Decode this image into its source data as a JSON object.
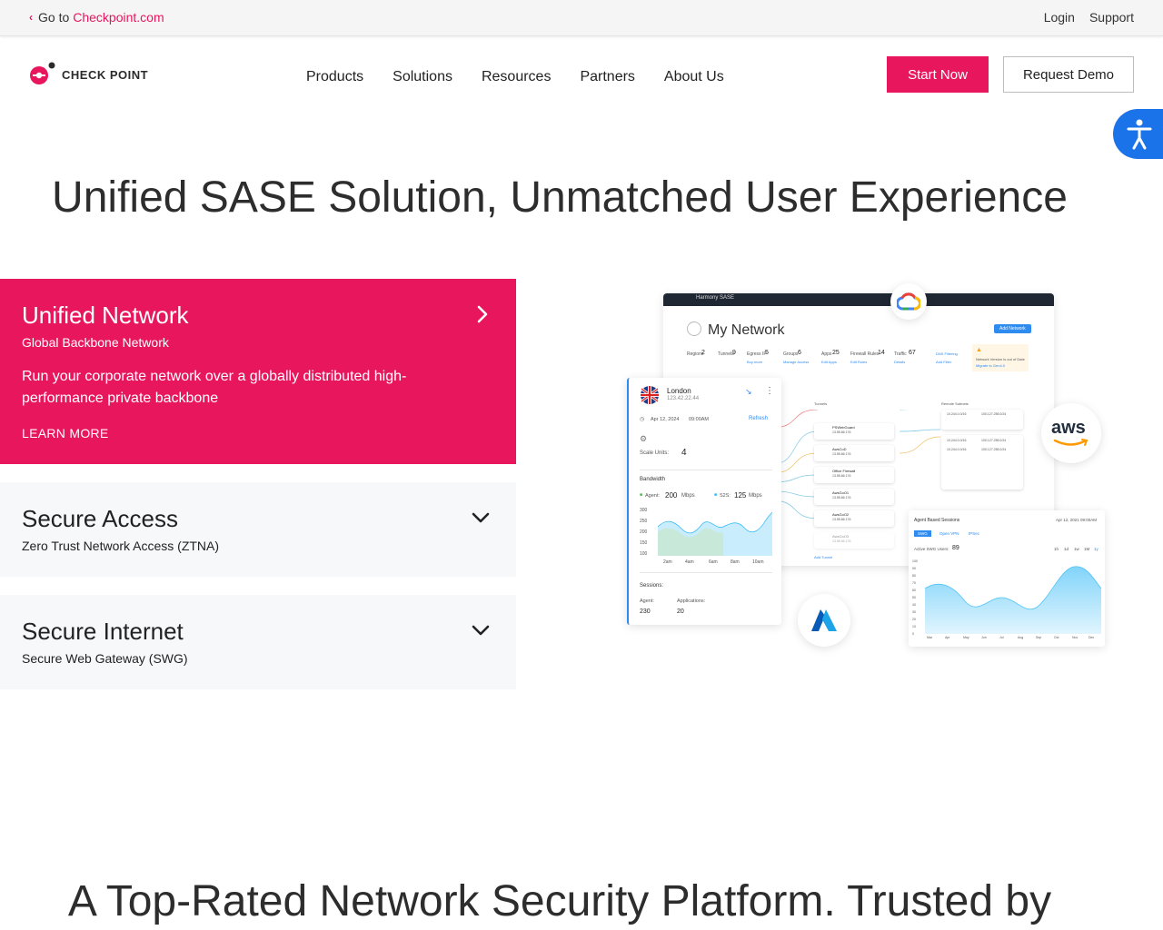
{
  "topbar": {
    "goto_prefix": "Go to",
    "goto_link": "Checkpoint.com",
    "login": "Login",
    "support": "Support"
  },
  "header": {
    "logo_text": "CHECK POINT",
    "nav": [
      "Products",
      "Solutions",
      "Resources",
      "Partners",
      "About Us"
    ],
    "start_label": "Start Now",
    "demo_label": "Request Demo"
  },
  "hero": {
    "title": "Unified SASE Solution, Unmatched User Experience"
  },
  "accordion": [
    {
      "title": "Unified Network",
      "subtitle": "Global Backbone Network",
      "description": "Run your corporate network over a globally distributed high-performance private backbone",
      "link": "LEARN MORE",
      "state": "expanded"
    },
    {
      "title": "Secure Access",
      "subtitle": "Zero Trust Network Access (ZTNA)",
      "state": "collapsed"
    },
    {
      "title": "Secure Internet",
      "subtitle": "Secure Web Gateway (SWG)",
      "state": "collapsed"
    }
  ],
  "dashboard": {
    "app_name": "Harmony SASE",
    "page_title": "My Network",
    "add_network": "Add Network",
    "stats": [
      {
        "label": "Regions",
        "value": "2"
      },
      {
        "label": "Tunnels",
        "value": "9"
      },
      {
        "label": "Egress IP",
        "value": "5"
      },
      {
        "label": "Groups",
        "value": "6"
      },
      {
        "label": "Apps",
        "value": "25"
      },
      {
        "label": "Firewall Rules",
        "value": "14"
      },
      {
        "label": "Traffic",
        "value": "67"
      }
    ],
    "stat_links": [
      "Buy more",
      "Manage Access",
      "Edit Apps",
      "Edit Rules",
      "Details",
      "Add Filter"
    ],
    "dns_filtering": "DNS Filtering",
    "version_notice": "Network Version is out of Date",
    "version_link": "Migrate to Gen4.0",
    "gateway": {
      "city": "London",
      "ip": "123.42.22.44",
      "date": "Apr 12, 2024",
      "time": "09:00AM",
      "refresh": "Refresh",
      "scale_label": "Scale Units:",
      "scale_value": "4",
      "bandwidth_label": "Bandwidth",
      "agent_label": "Agent:",
      "agent_value": "200",
      "agent_unit": "Mbps",
      "s2s_label": "S2S:",
      "s2s_value": "125",
      "s2s_unit": "Mbps",
      "y_ticks": [
        "300",
        "250",
        "200",
        "150",
        "100"
      ],
      "x_ticks": [
        "2am",
        "4am",
        "6am",
        "8am",
        "10am"
      ],
      "sessions_label": "Sessions:",
      "agent_sessions_label": "Agent:",
      "agent_sessions": "230",
      "apps_label": "Applications:",
      "apps_value": "20"
    },
    "tunnels_label": "Tunnels",
    "remote_subnets_label": "Remote Subnets",
    "tunnels": [
      "PSWebGuard",
      "AwsCoD",
      "Office Firewall",
      "AwsGoO1",
      "AwsGoO2",
      "AwsGoO3"
    ],
    "tunnel_ip": "13.55.66.176",
    "subnets": [
      "10.244.0.0/16",
      "100.127.255.0/24",
      "10.244.0.0/16",
      "100.127.255.0/24",
      "10.244.0.0/16",
      "100.127.255.0/24"
    ],
    "add_tunnel": "Add Tunnel",
    "sessions_panel": {
      "title": "Agent Based Sessions",
      "date": "Apr 12, 2021 09:00AM",
      "tabs": [
        "SWG",
        "Open VPN",
        "IPSec"
      ],
      "active_label": "Active SWG Users:",
      "active_value": "89",
      "ranges": [
        "1h",
        "1d",
        "1w",
        "1M",
        "1y"
      ],
      "y_ticks": [
        "100",
        "90",
        "80",
        "70",
        "60",
        "50",
        "40",
        "30",
        "20",
        "10",
        "0"
      ],
      "months": [
        "Mar",
        "Apr",
        "May",
        "Jun",
        "Jul",
        "Aug",
        "Sep",
        "Oct",
        "Nov",
        "Dec"
      ]
    },
    "cloud_badges": [
      "google-cloud-icon",
      "aws-icon",
      "azure-icon"
    ],
    "aws_text": "aws"
  },
  "bottom": {
    "title": "A Top-Rated Network Security Platform. Trusted by"
  },
  "colors": {
    "brand": "#e8175d",
    "accessibility": "#1a73e8",
    "dashboard_dark": "#1f2733"
  }
}
